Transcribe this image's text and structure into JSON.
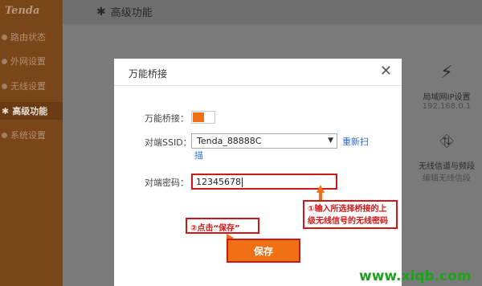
{
  "brand": {
    "logo_text": "Tenda"
  },
  "sidebar": {
    "items": [
      {
        "label": "路由状态",
        "active": false
      },
      {
        "label": "外网设置",
        "active": false
      },
      {
        "label": "无线设置",
        "active": false
      },
      {
        "label": "高级功能",
        "active": true
      },
      {
        "label": "系统设置",
        "active": false
      }
    ]
  },
  "header": {
    "title": "高级功能"
  },
  "tiles": [
    {
      "label": "局域网IP设置",
      "sub": "192.168.0.1",
      "icon": "network-icon"
    },
    {
      "label": "无线信道与频段",
      "sub": "编辑无线信段",
      "icon": "road-icon"
    }
  ],
  "dialog": {
    "title": "万能桥接",
    "bridge_label": "万能桥接：",
    "bridge_enabled": true,
    "ssid_label": "对端SSID：",
    "ssid_value": "Tenda_88888C",
    "rescan_text": "重新扫",
    "rescan_text2": "描",
    "password_label": "对端密码：",
    "password_value": "12345678",
    "save_label": "保存"
  },
  "annotations": {
    "note1_line1": "①输入所选择桥接的上",
    "note1_line2": "级无线信号的无线密码",
    "note2": "②点击“保存”"
  },
  "watermark": "www.xiqb.com",
  "colors": {
    "accent": "#f07015",
    "annotation": "#d01818",
    "link": "#2d6ad8",
    "watermark": "#1fa01f"
  }
}
